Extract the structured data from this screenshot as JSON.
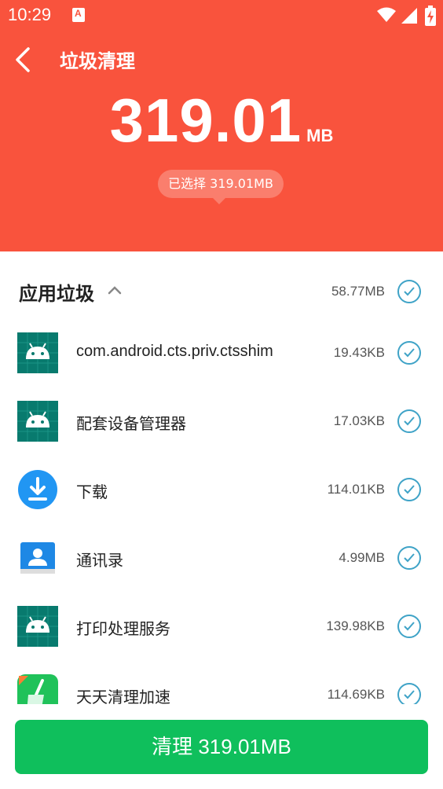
{
  "status_bar": {
    "time": "10:29",
    "notif_badge": "A"
  },
  "header": {
    "title": "垃圾清理",
    "total_value": "319.01",
    "total_unit": "MB",
    "selected_text": "已选择 319.01MB"
  },
  "section": {
    "title": "应用垃圾",
    "size": "58.77MB",
    "checked": true
  },
  "apps": [
    {
      "name": "com.android.cts.priv.ctsshim",
      "size": "19.43KB",
      "icon": "android-icon",
      "checked": true
    },
    {
      "name": "配套设备管理器",
      "size": "17.03KB",
      "icon": "android-icon",
      "checked": true
    },
    {
      "name": "下载",
      "size": "114.01KB",
      "icon": "download-icon",
      "checked": true
    },
    {
      "name": "通讯录",
      "size": "4.99MB",
      "icon": "contacts-icon",
      "checked": true
    },
    {
      "name": "打印处理服务",
      "size": "139.98KB",
      "icon": "android-icon",
      "checked": true
    },
    {
      "name": "天天清理加速",
      "size": "114.69KB",
      "icon": "broom-icon",
      "checked": true
    }
  ],
  "clean_button": {
    "label": "清理 319.01MB"
  },
  "colors": {
    "accent": "#f9533d",
    "button": "#0fbf5c",
    "check": "#3fa3c7"
  }
}
